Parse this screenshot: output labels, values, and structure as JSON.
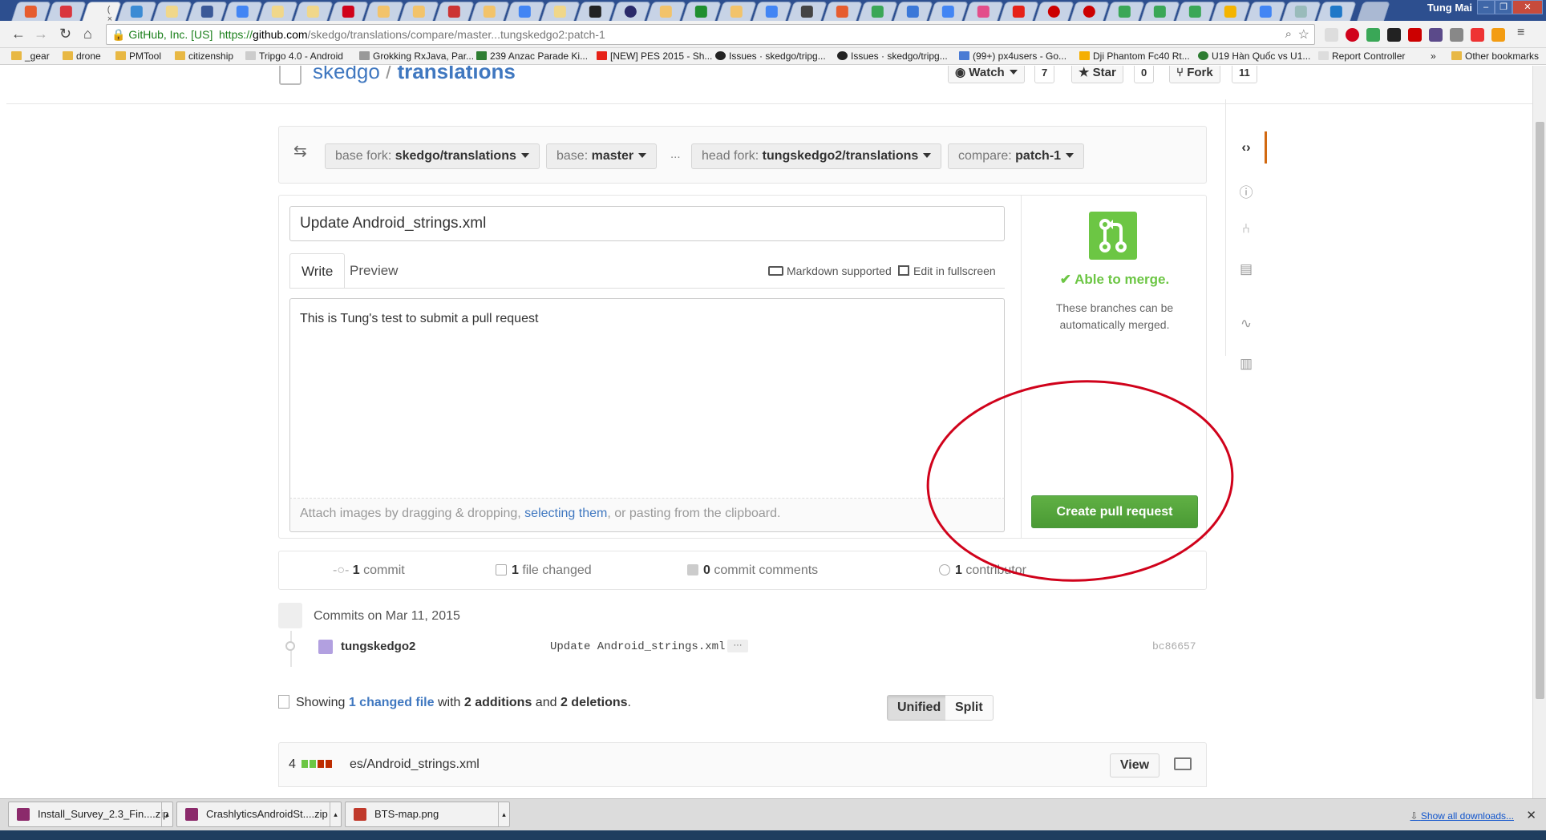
{
  "browser": {
    "profile_name": "Tung Mai",
    "security_label": "GitHub, Inc. [US]",
    "url_scheme": "https://",
    "url_host": "github.com",
    "url_path": "/skedgo/translations/compare/master...tungskedgo2:patch-1",
    "active_tab_label": "( ×"
  },
  "bookmarks": [
    {
      "label": "_gear",
      "icon": "folder-icon"
    },
    {
      "label": "drone",
      "icon": "folder-icon"
    },
    {
      "label": "PMTool",
      "icon": "folder-icon"
    },
    {
      "label": "citizenship",
      "icon": "folder-icon"
    },
    {
      "label": "Tripgo 4.0 - Android",
      "icon": "page-icon"
    },
    {
      "label": "Grokking RxJava, Par...",
      "icon": "page-icon"
    },
    {
      "label": "239 Anzac Parade Ki...",
      "icon": "m-icon"
    },
    {
      "label": "[NEW] PES 2015 - Sh...",
      "icon": "youtube-icon"
    },
    {
      "label": "Issues · skedgo/tripg...",
      "icon": "github-icon"
    },
    {
      "label": "Issues · skedgo/tripg...",
      "icon": "github-icon"
    },
    {
      "label": "(99+) px4users - Go...",
      "icon": "groups-icon"
    },
    {
      "label": "Dji Phantom Fc40 Rt...",
      "icon": "ebay-icon"
    },
    {
      "label": "U19 Hàn Quốc vs U1...",
      "icon": "ball-icon"
    },
    {
      "label": "Report Controller",
      "icon": "page-icon"
    }
  ],
  "bookmarks_overflow": "»",
  "other_bookmarks": "Other bookmarks",
  "repo": {
    "owner": "skedgo",
    "separator": " / ",
    "name": "translations",
    "watch_label": "Watch",
    "watch_count": "7",
    "star_label": "Star",
    "star_count": "0",
    "fork_label": "Fork",
    "fork_count": "11"
  },
  "compare": {
    "base_fork_key": "base fork:",
    "base_fork_value": "skedgo/translations",
    "base_key": "base:",
    "base_value": "master",
    "ellipsis": "...",
    "head_fork_key": "head fork:",
    "head_fork_value": "tungskedgo2/translations",
    "compare_key": "compare:",
    "compare_value": "patch-1"
  },
  "form": {
    "title_value": "Update Android_strings.xml",
    "tab_write": "Write",
    "tab_preview": "Preview",
    "markdown_label": "Markdown supported",
    "fullscreen_label": "Edit in fullscreen",
    "body_value": "This is Tung's test to submit a pull request",
    "attach_prefix": "Attach images by dragging & dropping, ",
    "attach_link": "selecting them",
    "attach_suffix": ", or pasting from the clipboard."
  },
  "merge": {
    "status": "✔ Able to merge.",
    "description": "These branches can be automatically merged.",
    "button_label": "Create pull request"
  },
  "summary": {
    "commits_count": "1",
    "commits_label": "commit",
    "files_count": "1",
    "files_label": "file changed",
    "comments_count": "0",
    "comments_label": "commit comments",
    "contributors_count": "1",
    "contributors_label": "contributor"
  },
  "commits": {
    "heading": "Commits on Mar 11, 2015",
    "rows": [
      {
        "author": "tungskedgo2",
        "message": "Update Android_strings.xml",
        "more": "···",
        "sha": "bc86657"
      }
    ]
  },
  "diffstat": {
    "showing": "Showing",
    "changed_link": "1 changed file",
    "with": "with",
    "additions": "2 additions",
    "and": "and",
    "deletions": "2 deletions",
    "unified_label": "Unified",
    "split_label": "Split"
  },
  "file": {
    "change_count": "4",
    "name": "es/Android_strings.xml",
    "view_label": "View"
  },
  "downloads": [
    {
      "name": "Install_Survey_2.3_Fin....zip",
      "icon": "winrar-icon"
    },
    {
      "name": "CrashlyticsAndroidSt....zip",
      "icon": "winrar-icon"
    },
    {
      "name": "BTS-map.png",
      "icon": "image-icon"
    }
  ],
  "show_all_downloads": "Show all downloads...",
  "colors": {
    "github_link": "#4078c0",
    "merge_green": "#6cc644",
    "button_green": "#55a532",
    "annotation_red": "#d0021b",
    "addition_block": "#6cc644",
    "deletion_block": "#bd2c00"
  }
}
